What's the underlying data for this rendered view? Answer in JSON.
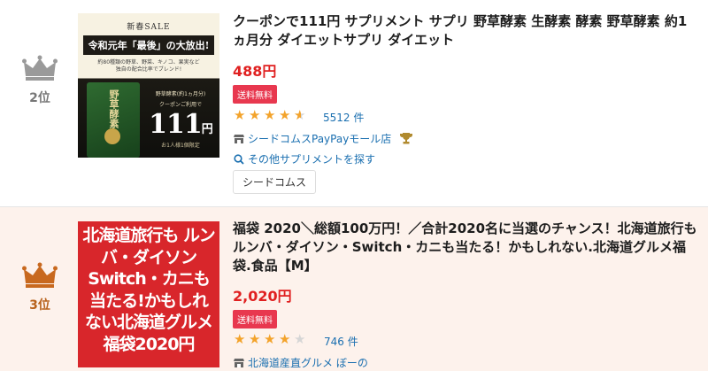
{
  "items": [
    {
      "rank_label": "2位",
      "crown_color": "#9a9a9a",
      "thumbnail": {
        "sale": "新春SALE",
        "headline": "令和元年「最後」の大放出!",
        "sub1": "約80種類の野草、野菜、キノコ、果実など",
        "sub2": "独自の配合比率でブレンド!",
        "bag": "野草酵素",
        "promo1": "野草酵素(約1ヵ月分)",
        "promo2": "クーポンご利用で",
        "promo_price": "111",
        "promo_unit": "円",
        "promo_note": "お1人様1個限定"
      },
      "title": "クーポンで111円 サプリメント サプリ 野草酵素 生酵素 酵素 野草酵素 約1ヵ月分 ダイエットサプリ ダイエット",
      "price": "488円",
      "shipping_badge": "送料無料",
      "rating": 4.5,
      "review_count": "5512 件",
      "store": "シードコムスPayPayモール店",
      "store_icon": "store-icon",
      "award_icon": "trophy-icon",
      "search_link": "その他サプリメントを探す",
      "tag": "シードコムス"
    },
    {
      "rank_label": "3位",
      "crown_color": "#c8691f",
      "thumbnail": {
        "text": "北海道旅行も ルンバ・ダイソン Switch・カニも 当たる!かもしれ ない北海道グルメ 福袋2020円"
      },
      "title": "福袋 2020＼総額100万円！／合計2020名に当選のチャンス！北海道旅行もルンバ・ダイソン・Switch・カニも当たる！かもしれない.北海道グルメ福袋.食品【M】",
      "price": "2,020円",
      "shipping_badge": "送料無料",
      "rating": 4,
      "review_count": "746 件",
      "store": "北海道産直グルメ ぼーの",
      "store_icon": "store-icon"
    }
  ],
  "colors": {
    "price": "#e02020",
    "badge": "#e8384f",
    "link": "#1a6fb0",
    "star": "#f3a32b",
    "row_highlight": "#fdf2ec"
  }
}
